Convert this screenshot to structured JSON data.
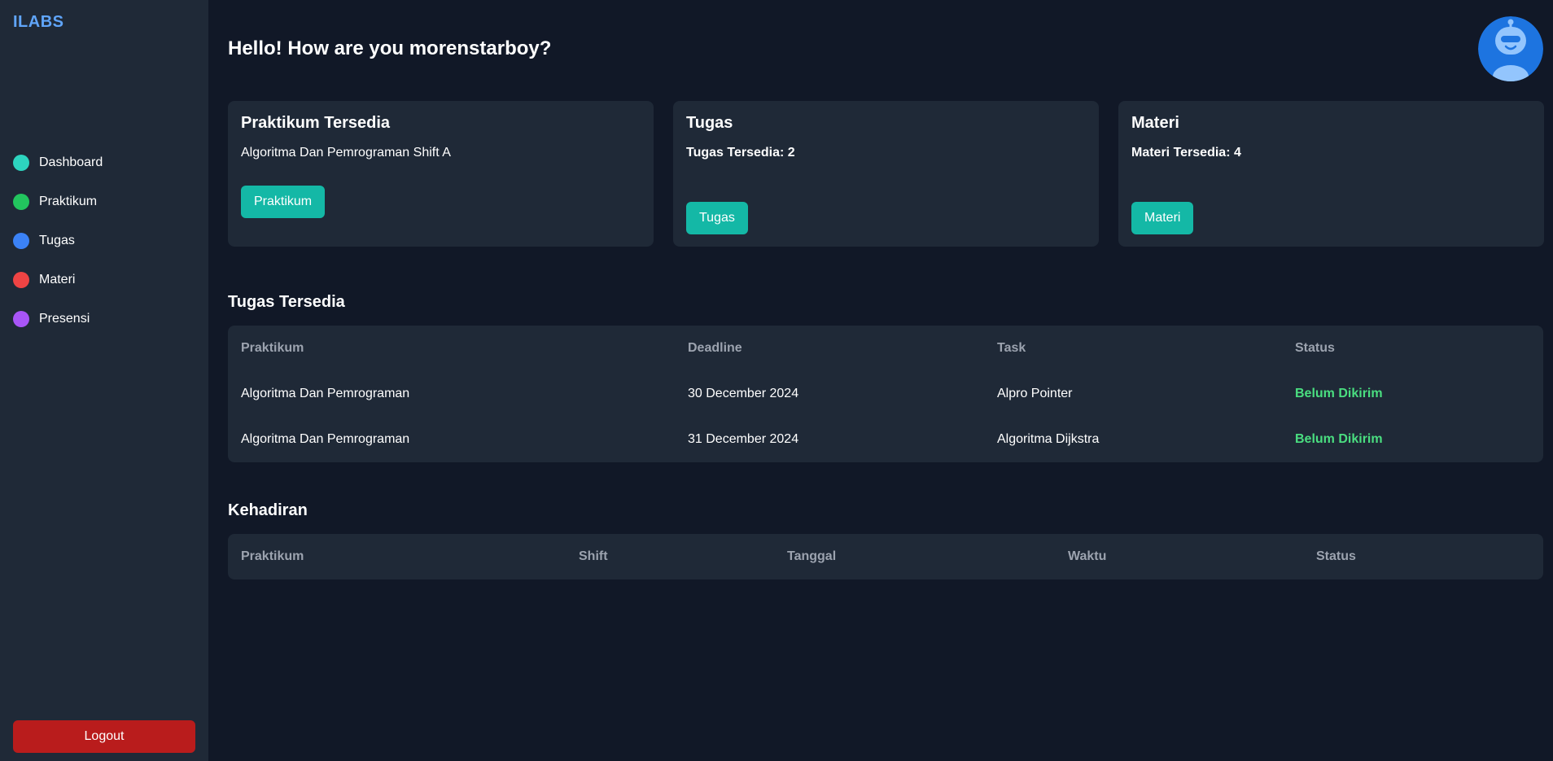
{
  "brand": "ILABS",
  "sidebar": {
    "items": [
      {
        "label": "Dashboard",
        "color": "#2dd4bf"
      },
      {
        "label": "Praktikum",
        "color": "#22c55e"
      },
      {
        "label": "Tugas",
        "color": "#3b82f6"
      },
      {
        "label": "Materi",
        "color": "#ef4444"
      },
      {
        "label": "Presensi",
        "color": "#a855f7"
      }
    ],
    "logout_label": "Logout"
  },
  "header": {
    "greeting": "Hello! How are you morenstarboy?",
    "avatar_icon": "robot-avatar-icon"
  },
  "cards": {
    "praktikum": {
      "title": "Praktikum Tersedia",
      "subtitle": "Algoritma Dan Pemrograman Shift A",
      "button": "Praktikum"
    },
    "tugas": {
      "title": "Tugas",
      "count_text": "Tugas Tersedia: 2",
      "button": "Tugas"
    },
    "materi": {
      "title": "Materi",
      "count_text": "Materi Tersedia: 4",
      "button": "Materi"
    }
  },
  "tugas_tersedia": {
    "title": "Tugas Tersedia",
    "columns": [
      "Praktikum",
      "Deadline",
      "Task",
      "Status"
    ],
    "rows": [
      [
        "Algoritma Dan Pemrograman",
        "30 December 2024",
        "Alpro Pointer",
        "Belum Dikirim"
      ],
      [
        "Algoritma Dan Pemrograman",
        "31 December 2024",
        "Algoritma Dijkstra",
        "Belum Dikirim"
      ]
    ]
  },
  "kehadiran": {
    "title": "Kehadiran",
    "columns": [
      "Praktikum",
      "Shift",
      "Tanggal",
      "Waktu",
      "Status"
    ]
  },
  "colors": {
    "background": "#111827",
    "panel": "#1f2937",
    "accent": "#14b8a6",
    "brand": "#60a5fa",
    "danger": "#b91c1c",
    "status_pending": "#4ade80"
  }
}
